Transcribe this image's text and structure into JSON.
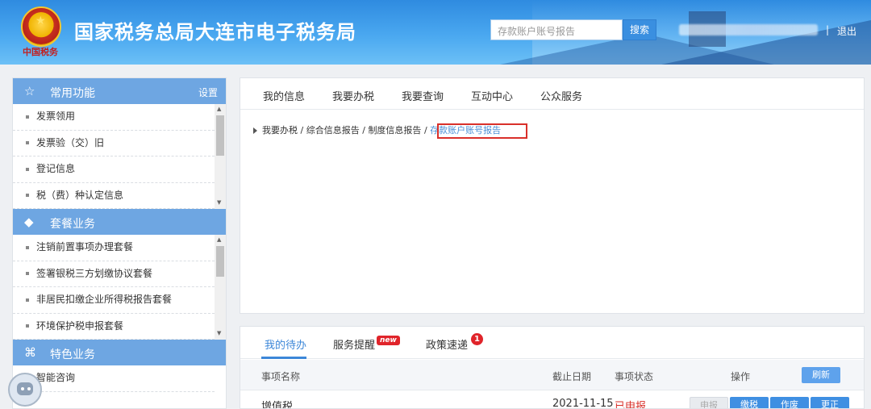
{
  "header": {
    "site_title": "国家税务总局大连市电子税务局",
    "emblem_caption": "中国税务",
    "search_placeholder": "存款账户账号报告",
    "search_button": "搜索",
    "separator": "|",
    "logout": "退出"
  },
  "left_panel": {
    "groups": [
      {
        "title": "常用功能",
        "icon": "star-outline-icon",
        "action": "设置",
        "items": [
          "发票领用",
          "发票验（交）旧",
          "登记信息",
          "税（费）种认定信息"
        ]
      },
      {
        "title": "套餐业务",
        "icon": "layers-icon",
        "items": [
          "注销前置事项办理套餐",
          "签署银税三方划缴协议套餐",
          "非居民扣缴企业所得税报告套餐",
          "环境保护税申报套餐"
        ]
      },
      {
        "title": "特色业务",
        "icon": "grid-clover-icon",
        "items": [
          "智能咨询"
        ]
      }
    ]
  },
  "top_nav": {
    "items": [
      "我的信息",
      "我要办税",
      "我要查询",
      "互动中心",
      "公众服务"
    ]
  },
  "breadcrumb": {
    "items": [
      "我要办税",
      "综合信息报告",
      "制度信息报告"
    ],
    "separator": "/",
    "current": "存款账户账号报告"
  },
  "tasks_panel": {
    "tabs": [
      {
        "label": "我的待办"
      },
      {
        "label": "服务提醒",
        "badge": "new"
      },
      {
        "label": "政策速递",
        "badge": "1"
      }
    ],
    "columns": [
      "事项名称",
      "截止日期",
      "事项状态",
      "操作"
    ],
    "refresh_button": "刷新",
    "rows": [
      {
        "name": "增值税",
        "deadline": "2021-11-15",
        "status": "已申报",
        "actions": [
          "申报",
          "缴税",
          "作废",
          "更正"
        ]
      }
    ]
  },
  "colors": {
    "header_blue": "#2f8be0",
    "group_head": "#6ea6e2",
    "accent_blue": "#3c87d8",
    "alert_red": "#e0242a"
  }
}
